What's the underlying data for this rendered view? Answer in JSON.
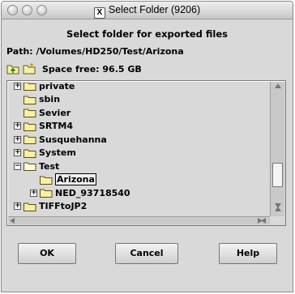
{
  "window": {
    "title": "Select Folder (9206)",
    "title_badge": "X"
  },
  "heading": "Select folder for exported files",
  "path": {
    "label": "Path:",
    "value": "/Volumes/HD250/Test/Arizona"
  },
  "toolbar": {
    "space_free": "Space free:  96.5 GB",
    "icons": [
      "up-folder-icon",
      "new-folder-icon"
    ]
  },
  "tree": {
    "items": [
      {
        "label": "private",
        "expandable": true,
        "level": 0
      },
      {
        "label": "sbin",
        "expandable": false,
        "level": 0
      },
      {
        "label": "Sevier",
        "expandable": false,
        "level": 0
      },
      {
        "label": "SRTM4",
        "expandable": true,
        "level": 0
      },
      {
        "label": "Susquehanna",
        "expandable": true,
        "level": 0
      },
      {
        "label": "System",
        "expandable": true,
        "level": 0
      },
      {
        "label": "Test",
        "expandable": true,
        "expanded": true,
        "level": 0
      },
      {
        "label": "Arizona",
        "expandable": false,
        "level": 1,
        "selected": true
      },
      {
        "label": "NED_93718540",
        "expandable": true,
        "level": 1
      },
      {
        "label": "TIFFtoJP2",
        "expandable": true,
        "level": 0
      }
    ]
  },
  "buttons": {
    "ok": "OK",
    "cancel": "Cancel",
    "help": "Help"
  }
}
